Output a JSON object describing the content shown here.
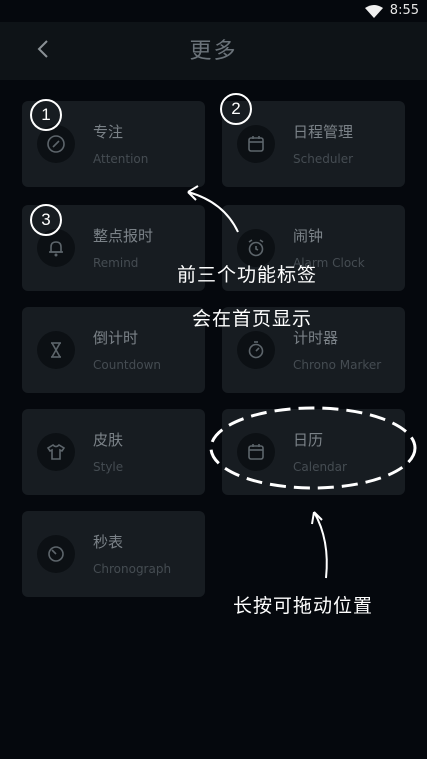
{
  "status_bar": {
    "time": "8:55"
  },
  "header": {
    "title": "更多"
  },
  "cards": [
    {
      "name": "专注",
      "sub": "Attention",
      "icon": "compass-icon"
    },
    {
      "name": "日程管理",
      "sub": "Scheduler",
      "icon": "calendar-icon"
    },
    {
      "name": "整点报时",
      "sub": "Remind",
      "icon": "bell-icon"
    },
    {
      "name": "闹钟",
      "sub": "Alarm Clock",
      "icon": "alarm-clock-icon"
    },
    {
      "name": "倒计时",
      "sub": "Countdown",
      "icon": "hourglass-icon"
    },
    {
      "name": "计时器",
      "sub": "Chrono Marker",
      "icon": "stopwatch-icon"
    },
    {
      "name": "皮肤",
      "sub": "Style",
      "icon": "tshirt-icon"
    },
    {
      "name": "日历",
      "sub": "Calendar",
      "icon": "calendar-icon"
    },
    {
      "name": "秒表",
      "sub": "Chronograph",
      "icon": "timer-icon"
    }
  ],
  "badges": [
    "1",
    "2",
    "3"
  ],
  "annotations": {
    "line1": "前三个功能标签",
    "line2": "会在首页显示",
    "drag_hint": "长按可拖动位置"
  }
}
